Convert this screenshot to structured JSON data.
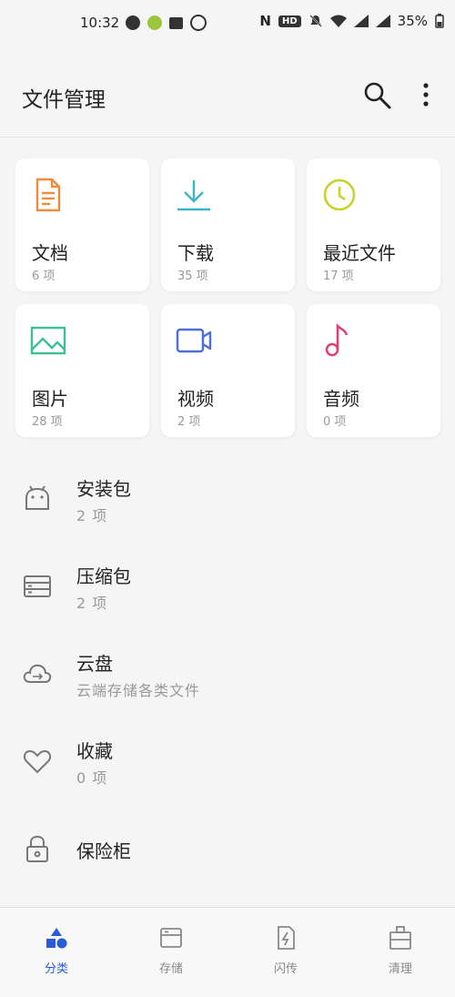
{
  "status_bar": {
    "time": "10:32",
    "hd_badge": "HD",
    "battery": "35%"
  },
  "header": {
    "title": "文件管理",
    "icons": [
      "search-icon",
      "more-icon"
    ]
  },
  "categories": [
    {
      "name": "文档",
      "count": "6 项",
      "icon": "document-icon",
      "color": "#f08a3c"
    },
    {
      "name": "下载",
      "count": "35 项",
      "icon": "download-icon",
      "color": "#3fb3c9"
    },
    {
      "name": "最近文件",
      "count": "17 项",
      "icon": "clock-icon",
      "color": "#c7d22a"
    },
    {
      "name": "图片",
      "count": "28 项",
      "icon": "image-icon",
      "color": "#3dbf98"
    },
    {
      "name": "视频",
      "count": "2 项",
      "icon": "video-icon",
      "color": "#4a6ee0"
    },
    {
      "name": "音频",
      "count": "0 项",
      "icon": "music-icon",
      "color": "#e0407a"
    }
  ],
  "list": [
    {
      "title": "安装包",
      "subtitle": "2 项",
      "icon": "android-icon"
    },
    {
      "title": "压缩包",
      "subtitle": "2 项",
      "icon": "archive-icon"
    },
    {
      "title": "云盘",
      "subtitle": "云端存储各类文件",
      "icon": "cloud-icon"
    },
    {
      "title": "收藏",
      "subtitle": "0 项",
      "icon": "heart-icon"
    },
    {
      "title": "保险柜",
      "subtitle": "",
      "icon": "lock-icon"
    }
  ],
  "bottom_nav": [
    {
      "label": "分类",
      "icon": "category-icon",
      "active": true
    },
    {
      "label": "存储",
      "icon": "storage-icon",
      "active": false
    },
    {
      "label": "闪传",
      "icon": "flash-transfer-icon",
      "active": false
    },
    {
      "label": "清理",
      "icon": "clean-icon",
      "active": false
    }
  ],
  "colors": {
    "accent": "#2a5bd7",
    "background": "#f5f5f5",
    "card": "#ffffff"
  }
}
